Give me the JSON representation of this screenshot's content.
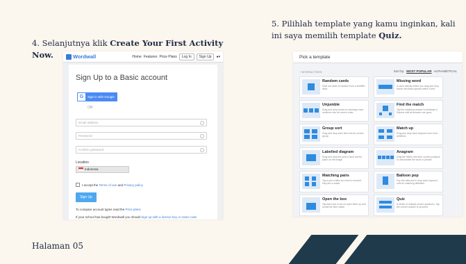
{
  "step4": {
    "prefix": "4. Selanjutnya klik ",
    "bold": "Create Your First Activity Now."
  },
  "step5": {
    "prefix": "5.  Pilihlah template yang kamu inginkan, kali ini saya memilih template ",
    "bold": "Quiz."
  },
  "footer": {
    "page": "Halaman 05"
  },
  "colors": {
    "background": "#fbf6ee",
    "stripes": "#1f3b4b",
    "text": "#1f2a44",
    "wordwall_blue": "#3a7bd5"
  },
  "signup": {
    "nav": {
      "logo": "Wordwall",
      "links": [
        "Home",
        "Features",
        "Price Plans"
      ],
      "login": "Log In",
      "signup": "Sign Up",
      "menu_icon": "globe-icon"
    },
    "title": "Sign Up to a Basic account",
    "google_button": "Sign in with Google",
    "or": "OR",
    "email_placeholder": "Email address",
    "password_placeholder": "Password",
    "confirm_placeholder": "Confirm password",
    "location_label": "Location",
    "location_value": "Indonesia",
    "terms_prefix": "I accept the ",
    "terms_link": "Terms of use",
    "terms_and": " and ",
    "privacy_link": "Privacy policy",
    "signup_button": "Sign Up",
    "compare_prefix": "To compare account types read the ",
    "compare_link": "Price plans",
    "school_prefix": "If your school has bought Wordwall you should ",
    "school_link": "Sign up with a licence key or invite code"
  },
  "templates": {
    "title": "Pick a template",
    "filter": "+ INTERACTIVES",
    "sort_label": "Sort by:",
    "sort_active": "MOST POPULAR",
    "sort_other": "ALPHABETICAL",
    "items": [
      {
        "name": "Random cards",
        "desc": "Deal out cards at random from a shuffled deck."
      },
      {
        "name": "Missing word",
        "desc": "A cloze activity where you drag and drop words into blank spaces within a text."
      },
      {
        "name": "Unjumble",
        "desc": "Drag and drop words to rearrange each sentence into its correct order."
      },
      {
        "name": "Find the match",
        "desc": "Tap the matching answer to eliminate it. Repeat until all answers are gone."
      },
      {
        "name": "Group sort",
        "desc": "Drag and drop each item into its correct group."
      },
      {
        "name": "Match up",
        "desc": "Drag and drop each keyword next to its definition."
      },
      {
        "name": "Labelled diagram",
        "desc": "Drag and drop the pins to their correct place on the image."
      },
      {
        "name": "Anagram",
        "desc": "Drag the letters into their correct positions to unscramble the word or phrase."
      },
      {
        "name": "Matching pairs",
        "desc": "Tap a pair of tiles at a time to reveal if they are a match."
      },
      {
        "name": "Balloon pop",
        "desc": "Pop the balloons to drop each keyword onto its matching definition."
      },
      {
        "name": "Open the box",
        "desc": "Tap each box in turn to open them up and reveal the item inside."
      },
      {
        "name": "Quiz",
        "desc": "A series of multiple choice questions. Tap the correct answer to proceed."
      }
    ]
  }
}
